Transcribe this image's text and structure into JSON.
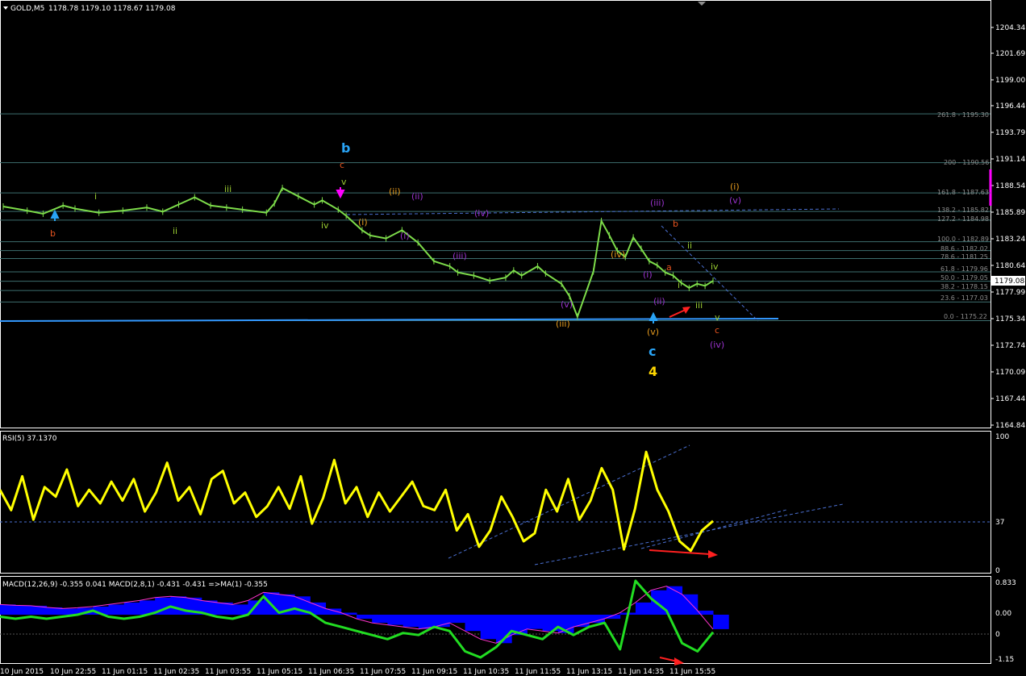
{
  "header": {
    "symbol": "GOLD,M5",
    "ohlc": "1178.78 1179.10 1178.67 1179.08",
    "rsi_title": "RSI(5) 37.1370",
    "macd_title": "MACD(12,26,9) -0.355 0.041  MACD(2,8,1) -0.431 -0.431  =>MA(1) -0.355"
  },
  "price_axis": {
    "ticks": [
      "1204.34",
      "1201.69",
      "1199.00",
      "1196.44",
      "1193.79",
      "1191.14",
      "1188.54",
      "1185.89",
      "1183.24",
      "1180.64",
      "1177.99",
      "1175.34",
      "1172.74",
      "1170.09",
      "1167.44",
      "1164.84"
    ],
    "current_price": "1179.08"
  },
  "rsi_axis": {
    "ticks": [
      "100",
      "37",
      "0"
    ]
  },
  "macd_axis": {
    "ticks": [
      "0.833",
      "0.00",
      "0",
      "-1.15"
    ]
  },
  "time_axis": {
    "labels": [
      "10 Jun 2015",
      "10 Jun 22:55",
      "11 Jun 01:15",
      "11 Jun 02:35",
      "11 Jun 03:55",
      "11 Jun 05:15",
      "11 Jun 06:35",
      "11 Jun 07:55",
      "11 Jun 09:15",
      "11 Jun 10:35",
      "11 Jun 11:55",
      "11 Jun 13:15",
      "11 Jun 14:35",
      "11 Jun 15:55"
    ]
  },
  "fib_levels": [
    {
      "label": "261.8 - 1195.30",
      "price": 1195.3
    },
    {
      "label": "200 - 1190.56",
      "price": 1190.56
    },
    {
      "label": "161.8 - 1187.63",
      "price": 1187.63
    },
    {
      "label": "138.2 - 1185.82",
      "price": 1185.82
    },
    {
      "label": "127.2 - 1184.98",
      "price": 1184.98
    },
    {
      "label": "100.0 - 1182.89",
      "price": 1182.89
    },
    {
      "label": "88.6 - 1182.02",
      "price": 1182.02
    },
    {
      "label": "78.6 - 1181.25",
      "price": 1181.25
    },
    {
      "label": "61.8 - 1179.96",
      "price": 1179.96
    },
    {
      "label": "50.0 - 1179.05",
      "price": 1179.05
    },
    {
      "label": "38.2 - 1178.15",
      "price": 1178.15
    },
    {
      "label": "23.6 - 1177.03",
      "price": 1177.03
    },
    {
      "label": "0.0 - 1175.22",
      "price": 1175.22
    }
  ],
  "wave_labels": [
    {
      "text": "b",
      "color": "#e8541f"
    },
    {
      "text": "i",
      "color": "#9acd32"
    },
    {
      "text": "ii",
      "color": "#9acd32"
    },
    {
      "text": "iii",
      "color": "#9acd32"
    },
    {
      "text": "iv",
      "color": "#9acd32"
    },
    {
      "text": "v",
      "color": "#9acd32"
    },
    {
      "text": "c",
      "color": "#e8541f"
    },
    {
      "text": "b",
      "color": "#29a3f5"
    },
    {
      "text": "(i)",
      "color": "#e69b1e"
    },
    {
      "text": "(ii)",
      "color": "#e69b1e"
    },
    {
      "text": "(ii)",
      "color": "#9932cc"
    },
    {
      "text": "(i)",
      "color": "#9932cc"
    },
    {
      "text": "(iii)",
      "color": "#9932cc"
    },
    {
      "text": "(iv)",
      "color": "#9932cc"
    },
    {
      "text": "(v)",
      "color": "#9932cc"
    },
    {
      "text": "(iii)",
      "color": "#e69b1e"
    },
    {
      "text": "(iv)",
      "color": "#e69b1e"
    },
    {
      "text": "(i)",
      "color": "#9932cc"
    },
    {
      "text": "(ii)",
      "color": "#9932cc"
    },
    {
      "text": "(iii)",
      "color": "#9932cc"
    },
    {
      "text": "(v)",
      "color": "#e69b1e"
    },
    {
      "text": "c",
      "color": "#29a3f5"
    },
    {
      "text": "4",
      "color": "#ffd700"
    },
    {
      "text": "a",
      "color": "#e8541f"
    },
    {
      "text": "b",
      "color": "#e8541f"
    },
    {
      "text": "i",
      "color": "#9acd32"
    },
    {
      "text": "ii",
      "color": "#9acd32"
    },
    {
      "text": "iii",
      "color": "#9acd32"
    },
    {
      "text": "iv",
      "color": "#9acd32"
    },
    {
      "text": "v",
      "color": "#9acd32"
    },
    {
      "text": "c",
      "color": "#e8541f"
    },
    {
      "text": "(iv)",
      "color": "#9932cc"
    },
    {
      "text": "(i)",
      "color": "#e69b1e"
    },
    {
      "text": "(v)",
      "color": "#9932cc"
    }
  ],
  "colors": {
    "background": "#000000",
    "price_line": "#7ddc4a",
    "rsi_line": "#ffff00",
    "macd_line": "#22dd22",
    "macd_signal": "#ff33cc",
    "histogram": "#0000ff",
    "grid_line": "#3d6e6e",
    "support_line": "#3399ff",
    "arrow": "#ff2020"
  },
  "chart_data": [
    {
      "type": "line",
      "title": "GOLD,M5",
      "x_labels": [
        "10 Jun 2015",
        "10 Jun 22:55",
        "11 Jun 01:15",
        "11 Jun 02:35",
        "11 Jun 03:55",
        "11 Jun 05:15",
        "11 Jun 06:35",
        "11 Jun 07:55",
        "11 Jun 09:15",
        "11 Jun 10:35",
        "11 Jun 11:55",
        "11 Jun 13:15",
        "11 Jun 14:35",
        "11 Jun 15:55"
      ],
      "x": [
        0,
        6,
        10,
        15,
        18,
        24,
        30,
        36,
        40,
        44,
        48,
        52,
        56,
        60,
        66,
        68,
        70,
        74,
        78,
        80,
        84,
        86,
        90,
        92,
        96,
        100,
        104,
        108,
        112,
        114,
        118,
        122,
        126,
        128,
        130,
        134,
        136,
        140,
        142,
        144,
        148,
        150,
        152,
        154,
        156,
        158,
        160,
        162,
        164,
        166,
        168,
        170,
        172,
        174,
        176,
        178
      ],
      "y": [
        1186.3,
        1185.9,
        1185.6,
        1186.4,
        1186.1,
        1185.7,
        1185.9,
        1186.2,
        1185.8,
        1186.5,
        1187.2,
        1186.4,
        1186.2,
        1186.0,
        1185.7,
        1186.6,
        1188.1,
        1187.3,
        1186.5,
        1186.9,
        1186.0,
        1185.4,
        1184.0,
        1183.5,
        1183.2,
        1184.0,
        1182.8,
        1181.0,
        1180.5,
        1179.9,
        1179.6,
        1179.1,
        1179.4,
        1180.1,
        1179.6,
        1180.5,
        1179.8,
        1178.8,
        1177.6,
        1175.6,
        1180.0,
        1184.9,
        1183.5,
        1182.0,
        1181.4,
        1183.3,
        1182.2,
        1181.0,
        1180.6,
        1179.9,
        1179.6,
        1178.9,
        1178.4,
        1178.8,
        1178.6,
        1179.08
      ],
      "ylim": [
        1164.84,
        1206.2
      ]
    },
    {
      "type": "line",
      "title": "RSI(5) 37.1370",
      "series": [
        {
          "name": "RSI(5)",
          "values": [
            60,
            45,
            70,
            38,
            62,
            55,
            75,
            48,
            60,
            50,
            66,
            52,
            68,
            44,
            58,
            80,
            52,
            62,
            42,
            68,
            74,
            50,
            58,
            40,
            48,
            62,
            46,
            70,
            35,
            54,
            82,
            50,
            62,
            40,
            58,
            44,
            55,
            66,
            48,
            45,
            60,
            30,
            42,
            18,
            30,
            55,
            40,
            22,
            28,
            60,
            44,
            68,
            38,
            52,
            76,
            60,
            16,
            46,
            88,
            60,
            44,
            22,
            15,
            30,
            37
          ]
        }
      ],
      "ylim": [
        0,
        100
      ]
    },
    {
      "type": "line",
      "title": "MACD(12,26,9) -0.355 0.041  MACD(2,8,1) -0.431 -0.431  =>MA(1) -0.355",
      "series": [
        {
          "name": "MACD(12,26,9)",
          "values": [
            0.25,
            0.23,
            0.22,
            0.18,
            0.15,
            0.17,
            0.2,
            0.25,
            0.3,
            0.35,
            0.42,
            0.45,
            0.42,
            0.35,
            0.3,
            0.25,
            0.35,
            0.55,
            0.5,
            0.45,
            0.3,
            0.15,
            0.05,
            -0.1,
            -0.2,
            -0.25,
            -0.3,
            -0.35,
            -0.3,
            -0.2,
            -0.4,
            -0.6,
            -0.7,
            -0.5,
            -0.35,
            -0.4,
            -0.45,
            -0.3,
            -0.2,
            -0.1,
            0.05,
            0.3,
            0.6,
            0.7,
            0.5,
            0.1,
            -0.355
          ]
        },
        {
          "name": "MACD(2,8,1)",
          "values": [
            -0.05,
            -0.1,
            -0.05,
            -0.1,
            -0.05,
            0.0,
            0.1,
            -0.05,
            -0.1,
            -0.05,
            0.05,
            0.2,
            0.1,
            0.05,
            -0.05,
            -0.1,
            0.0,
            0.45,
            0.05,
            0.15,
            0.05,
            -0.2,
            -0.3,
            -0.4,
            -0.5,
            -0.6,
            -0.45,
            -0.5,
            -0.3,
            -0.4,
            -0.9,
            -1.05,
            -0.8,
            -0.4,
            -0.5,
            -0.6,
            -0.3,
            -0.5,
            -0.3,
            -0.2,
            -0.85,
            0.833,
            0.4,
            0.1,
            -0.7,
            -0.9,
            -0.431
          ]
        }
      ],
      "ylim": [
        -1.15,
        0.833
      ]
    }
  ]
}
